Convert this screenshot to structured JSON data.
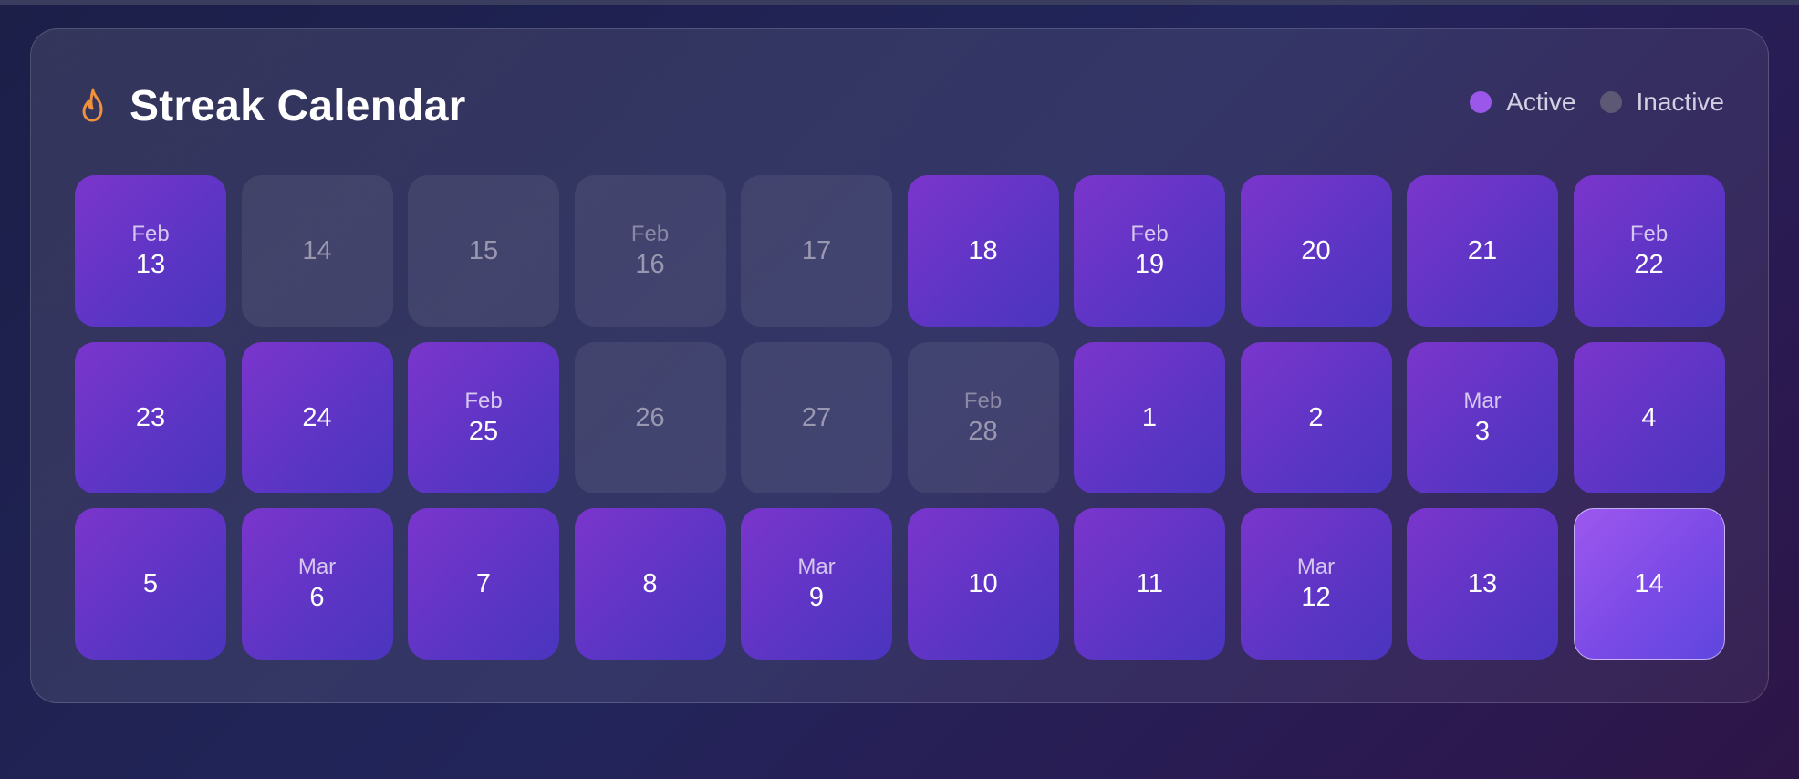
{
  "header": {
    "title": "Streak Calendar",
    "icon": "flame-icon",
    "icon_color": "#f0913c"
  },
  "legend": [
    {
      "label": "Active",
      "color": "#9b57ea"
    },
    {
      "label": "Inactive",
      "color": "#5d5975"
    }
  ],
  "days": [
    {
      "month": "Feb",
      "day": "13",
      "active": true
    },
    {
      "month": "",
      "day": "14",
      "active": false
    },
    {
      "month": "",
      "day": "15",
      "active": false
    },
    {
      "month": "Feb",
      "day": "16",
      "active": false
    },
    {
      "month": "",
      "day": "17",
      "active": false
    },
    {
      "month": "",
      "day": "18",
      "active": true
    },
    {
      "month": "Feb",
      "day": "19",
      "active": true
    },
    {
      "month": "",
      "day": "20",
      "active": true
    },
    {
      "month": "",
      "day": "21",
      "active": true
    },
    {
      "month": "Feb",
      "day": "22",
      "active": true
    },
    {
      "month": "",
      "day": "23",
      "active": true
    },
    {
      "month": "",
      "day": "24",
      "active": true
    },
    {
      "month": "Feb",
      "day": "25",
      "active": true
    },
    {
      "month": "",
      "day": "26",
      "active": false
    },
    {
      "month": "",
      "day": "27",
      "active": false
    },
    {
      "month": "Feb",
      "day": "28",
      "active": false
    },
    {
      "month": "",
      "day": "1",
      "active": true
    },
    {
      "month": "",
      "day": "2",
      "active": true
    },
    {
      "month": "Mar",
      "day": "3",
      "active": true
    },
    {
      "month": "",
      "day": "4",
      "active": true
    },
    {
      "month": "",
      "day": "5",
      "active": true
    },
    {
      "month": "Mar",
      "day": "6",
      "active": true
    },
    {
      "month": "",
      "day": "7",
      "active": true
    },
    {
      "month": "",
      "day": "8",
      "active": true
    },
    {
      "month": "Mar",
      "day": "9",
      "active": true
    },
    {
      "month": "",
      "day": "10",
      "active": true
    },
    {
      "month": "",
      "day": "11",
      "active": true
    },
    {
      "month": "Mar",
      "day": "12",
      "active": true
    },
    {
      "month": "",
      "day": "13",
      "active": true
    },
    {
      "month": "",
      "day": "14",
      "active": true,
      "today": true
    }
  ]
}
